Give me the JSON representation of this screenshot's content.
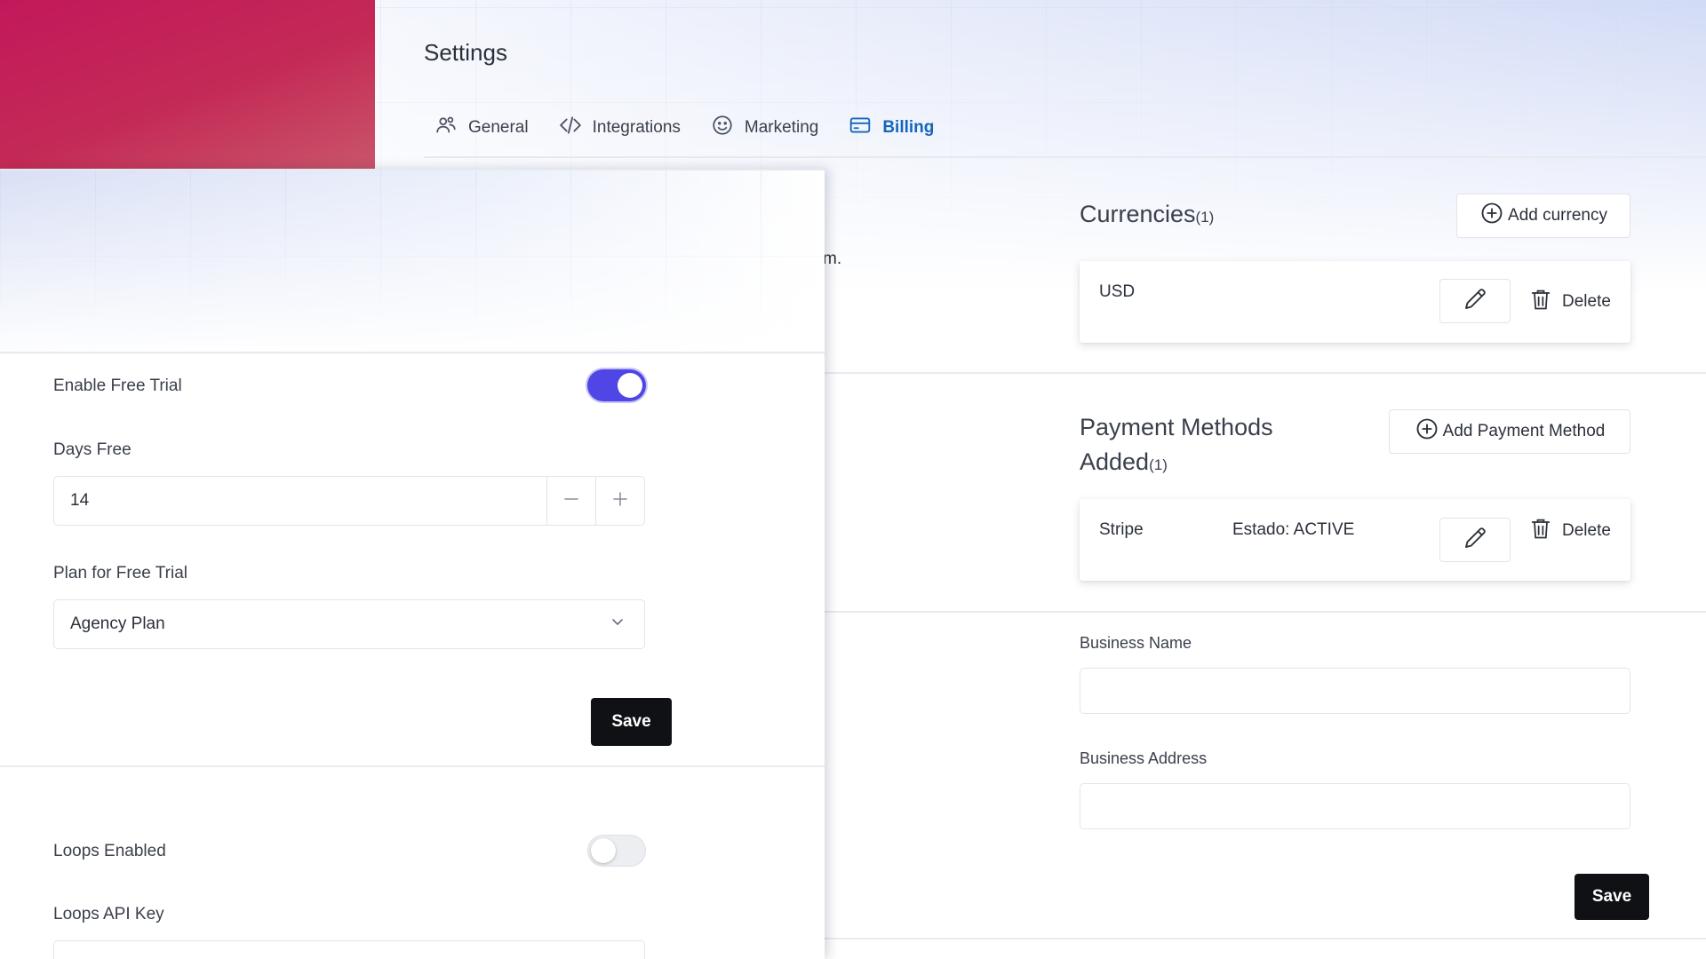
{
  "header": {
    "title": "Settings",
    "tabs": [
      {
        "label": "General",
        "icon": "users-gear-icon",
        "active": false
      },
      {
        "label": "Integrations",
        "icon": "code-icon",
        "active": false
      },
      {
        "label": "Marketing",
        "icon": "smile-icon",
        "active": false
      },
      {
        "label": "Billing",
        "icon": "credit-card-icon",
        "active": true
      }
    ]
  },
  "colors": {
    "brand": "#c2185b",
    "accent": "#1565c0",
    "toggle_on": "#4f46e5",
    "dark_button": "#101114"
  },
  "currencies": {
    "heading": "Currencies",
    "count": "(1)",
    "add_label": "Add currency",
    "items": [
      {
        "code": "USD",
        "delete_label": "Delete"
      }
    ]
  },
  "payment_methods": {
    "heading_line1": "Payment Methods",
    "heading_line2": "Added",
    "count": "(1)",
    "add_label": "Add Payment Method",
    "items": [
      {
        "name": "Stripe",
        "status": "Estado: ACTIVE",
        "delete_label": "Delete"
      }
    ]
  },
  "business": {
    "name_label": "Business Name",
    "name_value": "",
    "address_label": "Business Address",
    "address_value": "",
    "save_label": "Save"
  },
  "obscured_text": "m.",
  "free_trial": {
    "enable_label": "Enable Free Trial",
    "enabled": true,
    "days_label": "Days Free",
    "days_value": "14",
    "plan_label": "Plan for Free Trial",
    "plan_value": "Agency Plan",
    "save_label": "Save"
  },
  "loops": {
    "enabled_label": "Loops Enabled",
    "enabled": false,
    "api_key_label": "Loops API Key"
  }
}
